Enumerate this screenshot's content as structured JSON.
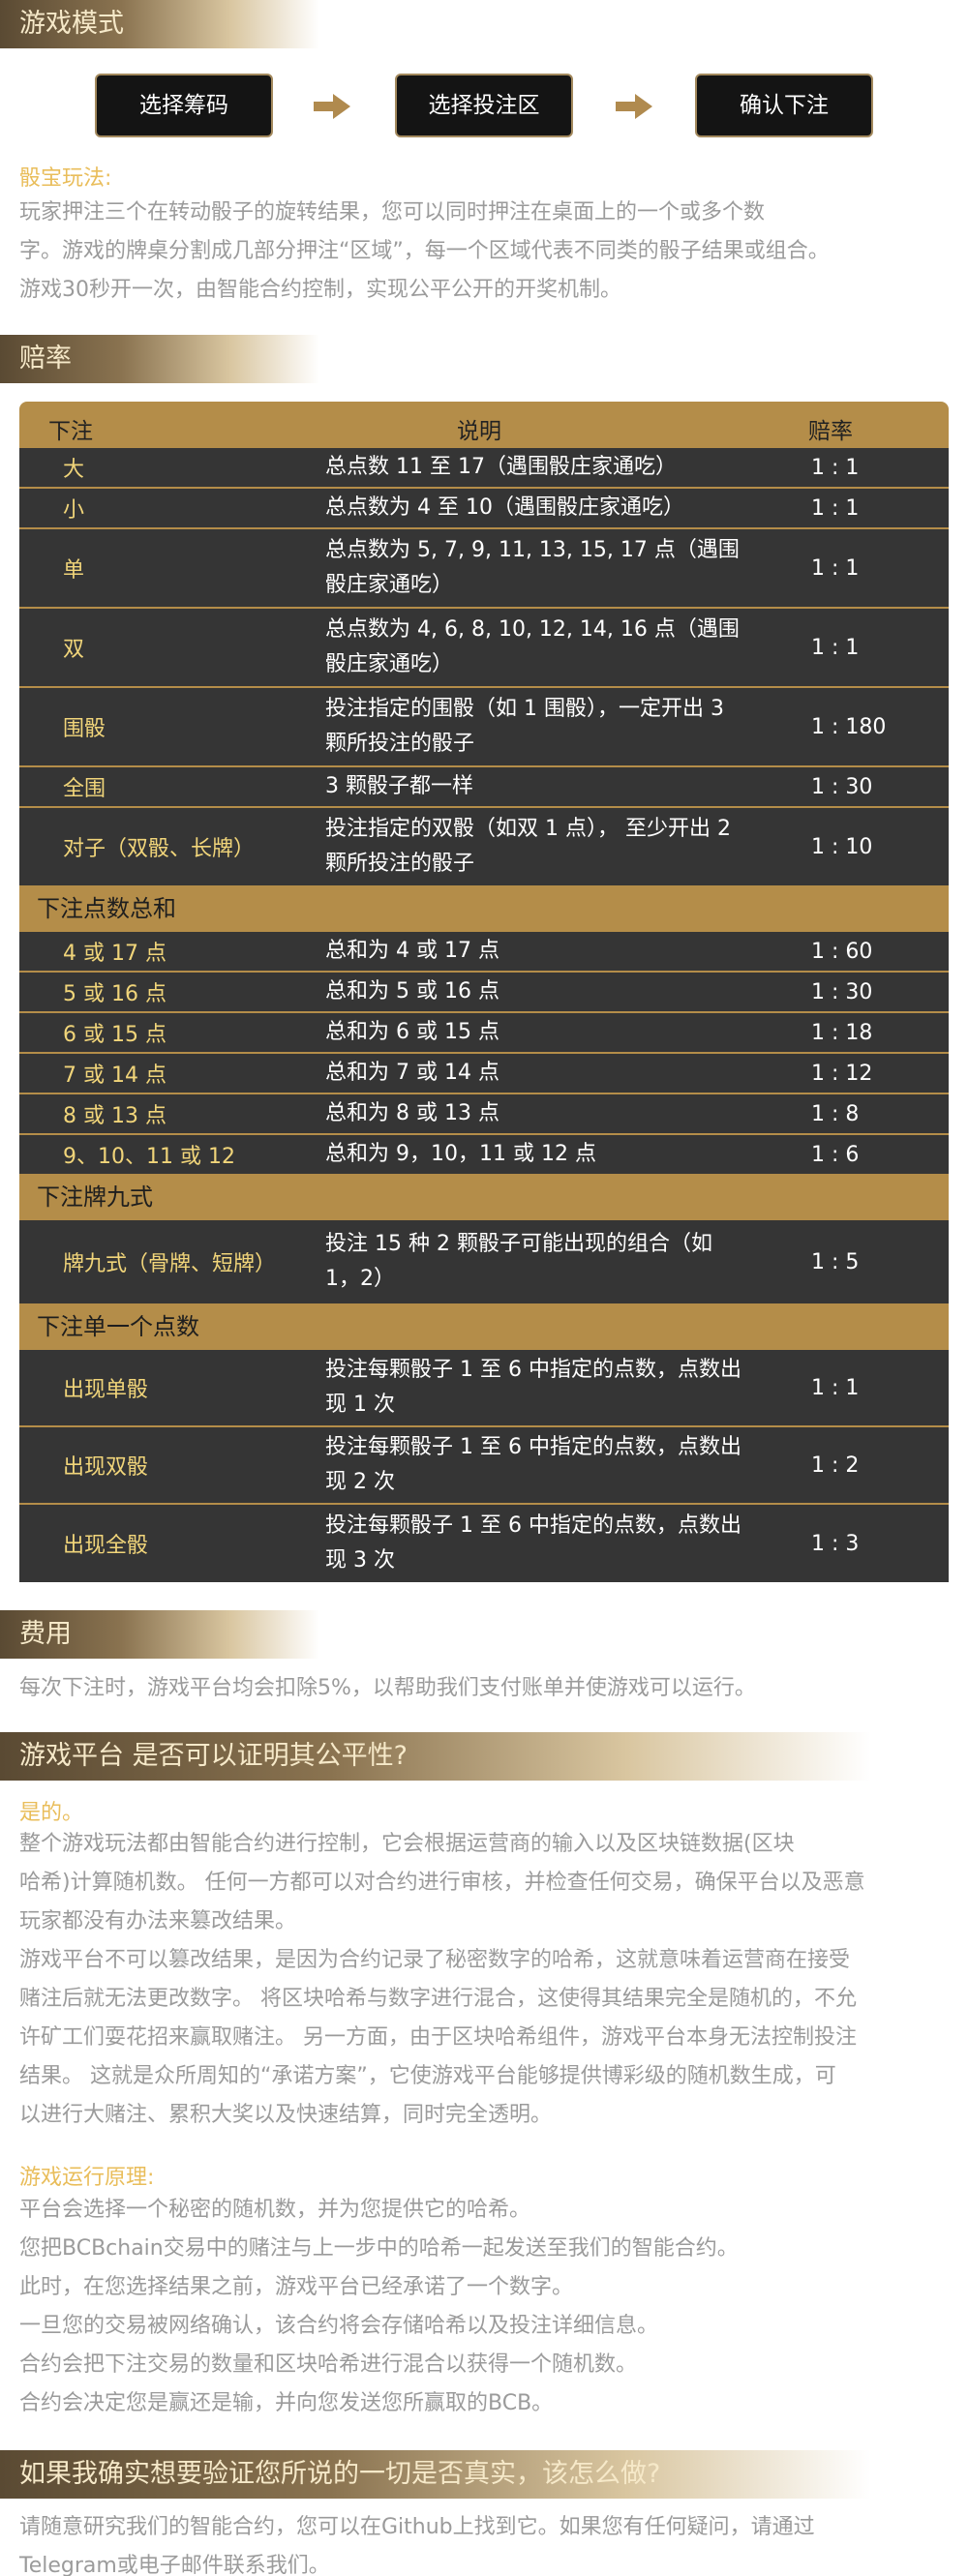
{
  "sections": {
    "game_mode": "游戏模式",
    "odds": "赔率",
    "fees": "费用",
    "platform": "游戏平台 是否可以证明其公平性?",
    "verify": "如果我确实想要验证您所说的一切是否真实，该怎么做?"
  },
  "steps": [
    "选择筹码",
    "选择投注区",
    "确认下注"
  ],
  "sicbo": {
    "label": "骰宝玩法:",
    "lines": [
      "玩家押注三个在转动骰子的旋转结果，您可以同时押注在桌面上的一个或多个数",
      "字。游戏的牌桌分割成几部分押注“区域”，每一个区域代表不同类的骰子结果或组合。",
      "游戏30秒开一次，由智能合约控制，实现公平公开的开奖机制。"
    ]
  },
  "table": {
    "headers": [
      "下注",
      "说明",
      "赔率"
    ],
    "main_rows": [
      {
        "bet": "大",
        "desc": "总点数 11 至 17（遇围骰庄家通吃）",
        "odds": "1 : 1"
      },
      {
        "bet": "小",
        "desc": "总点数为 4 至 10（遇围骰庄家通吃）",
        "odds": "1 : 1"
      },
      {
        "bet": "单",
        "desc": "总点数为 5, 7, 9, 11, 13, 15, 17 点（遇围骰庄家通吃）",
        "odds": "1 : 1"
      },
      {
        "bet": "双",
        "desc": "总点数为 4, 6, 8, 10, 12, 14, 16 点（遇围骰庄家通吃）",
        "odds": "1 : 1"
      },
      {
        "bet": "围骰",
        "desc": "投注指定的围骰（如 1 围骰），一定开出 3 颗所投注的骰子",
        "odds": "1 : 180"
      },
      {
        "bet": "全围",
        "desc": "3 颗骰子都一样",
        "odds": "1 : 30"
      },
      {
        "bet": "对子（双骰、长牌）",
        "desc": "投注指定的双骰（如双 1 点）， 至少开出 2 颗所投注的骰子",
        "odds": "1 : 10"
      }
    ],
    "group_sum": "下注点数总和",
    "sum_rows": [
      {
        "bet": "4 或 17 点",
        "desc": "总和为 4 或 17 点",
        "odds": "1 : 60"
      },
      {
        "bet": "5 或 16 点",
        "desc": "总和为 5 或 16 点",
        "odds": "1 : 30"
      },
      {
        "bet": "6 或 15 点",
        "desc": "总和为 6 或 15 点",
        "odds": "1 : 18"
      },
      {
        "bet": "7 或 14 点",
        "desc": "总和为 7 或 14 点",
        "odds": "1 : 12"
      },
      {
        "bet": "8 或 13 点",
        "desc": "总和为 8 或 13 点",
        "odds": "1 : 8"
      },
      {
        "bet": "9、10、11 或 12",
        "desc": "总和为 9，10，11 或 12 点",
        "odds": "1 : 6"
      }
    ],
    "group_domino": "下注牌九式",
    "domino_rows": [
      {
        "bet": "牌九式（骨牌、短牌）",
        "desc": "投注 15 种 2 颗骰子可能出现的组合（如 1，2）",
        "odds": "1 : 5"
      }
    ],
    "group_single": "下注单一个点数",
    "single_rows": [
      {
        "bet": "出现单骰",
        "desc": "投注每颗骰子 1 至 6 中指定的点数，点数出现 1 次",
        "odds": "1 : 1"
      },
      {
        "bet": "出现双骰",
        "desc": "投注每颗骰子 1 至 6 中指定的点数，点数出现 2 次",
        "odds": "1 : 2"
      },
      {
        "bet": "出现全骰",
        "desc": "投注每颗骰子 1 至 6 中指定的点数，点数出现 3 次",
        "odds": "1 : 3"
      }
    ]
  },
  "fees_text": "每次下注时，游戏平台均会扣除5%，以帮助我们支付账单并使游戏可以运行。",
  "platform": {
    "label": "是的。",
    "lines": [
      "整个游戏玩法都由智能合约进行控制，它会根据运营商的输入以及区块链数据(区块",
      "哈希)计算随机数。 任何一方都可以对合约进行审核，并检查任何交易，确保平台以及恶意",
      "玩家都没有办法来篡改结果。",
      "游戏平台不可以篡改结果，是因为合约记录了秘密数字的哈希，这就意味着运营商在接受",
      "赌注后就无法更改数字。 将区块哈希与数字进行混合，这使得其结果完全是随机的，不允",
      "许矿工们耍花招来赢取赌注。 另一方面，由于区块哈希组件，游戏平台本身无法控制投注",
      "结果。 这就是众所周知的“承诺方案”，它使游戏平台能够提供博彩级的随机数生成，可",
      "以进行大赌注、累积大奖以及快速结算，同时完全透明。"
    ]
  },
  "principle": {
    "label": "游戏运行原理:",
    "lines": [
      "平台会选择一个秘密的随机数，并为您提供它的哈希。",
      "您把BCBchain交易中的赌注与上一步中的哈希一起发送至我们的智能合约。",
      "此时，在您选择结果之前，游戏平台已经承诺了一个数字。",
      "一旦您的交易被网络确认，该合约将会存储哈希以及投注详细信息。",
      "合约会把下注交易的数量和区块哈希进行混合以获得一个随机数。",
      "合约会决定您是赢还是输，并向您发送您所赢取的BCB。"
    ]
  },
  "verify_lines": [
    "请随意研究我们的智能合约，您可以在Github上找到它。如果您有任何疑问，请通过",
    "Telegram或电子邮件联系我们。"
  ]
}
